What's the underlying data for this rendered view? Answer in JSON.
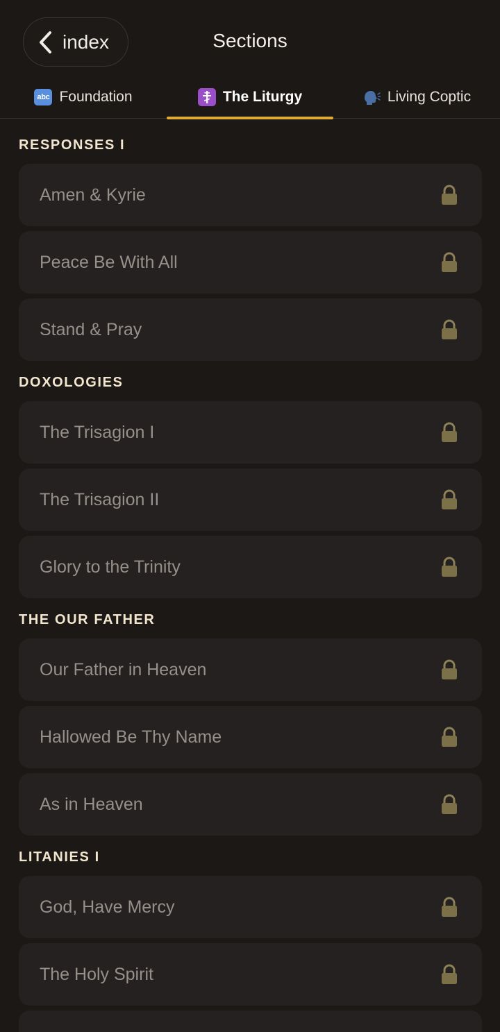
{
  "header": {
    "back_label": "index",
    "title": "Sections"
  },
  "tabs": [
    {
      "label": "Foundation",
      "icon": "abc-icon"
    },
    {
      "label": "The Liturgy",
      "icon": "orthodox-cross-icon",
      "active": true
    },
    {
      "label": "Living Coptic",
      "icon": "speaking-head-icon"
    }
  ],
  "sections": [
    {
      "title": "RESPONSES I",
      "items": [
        "Amen & Kyrie",
        "Peace Be With All",
        "Stand & Pray"
      ]
    },
    {
      "title": "DOXOLOGIES",
      "items": [
        "The Trisagion I",
        "The Trisagion II",
        "Glory to the Trinity"
      ]
    },
    {
      "title": "THE OUR FATHER",
      "items": [
        "Our Father in Heaven",
        "Hallowed Be Thy Name",
        "As in Heaven"
      ]
    },
    {
      "title": "LITANIES I",
      "items": [
        "God, Have Mercy",
        "The Holy Spirit"
      ]
    }
  ],
  "colors": {
    "background": "#1c1816",
    "card": "#252120",
    "accent": "#e0ab34",
    "lock": "#7b7048"
  },
  "icons": {
    "tab_foundation_glyph": "abc"
  }
}
